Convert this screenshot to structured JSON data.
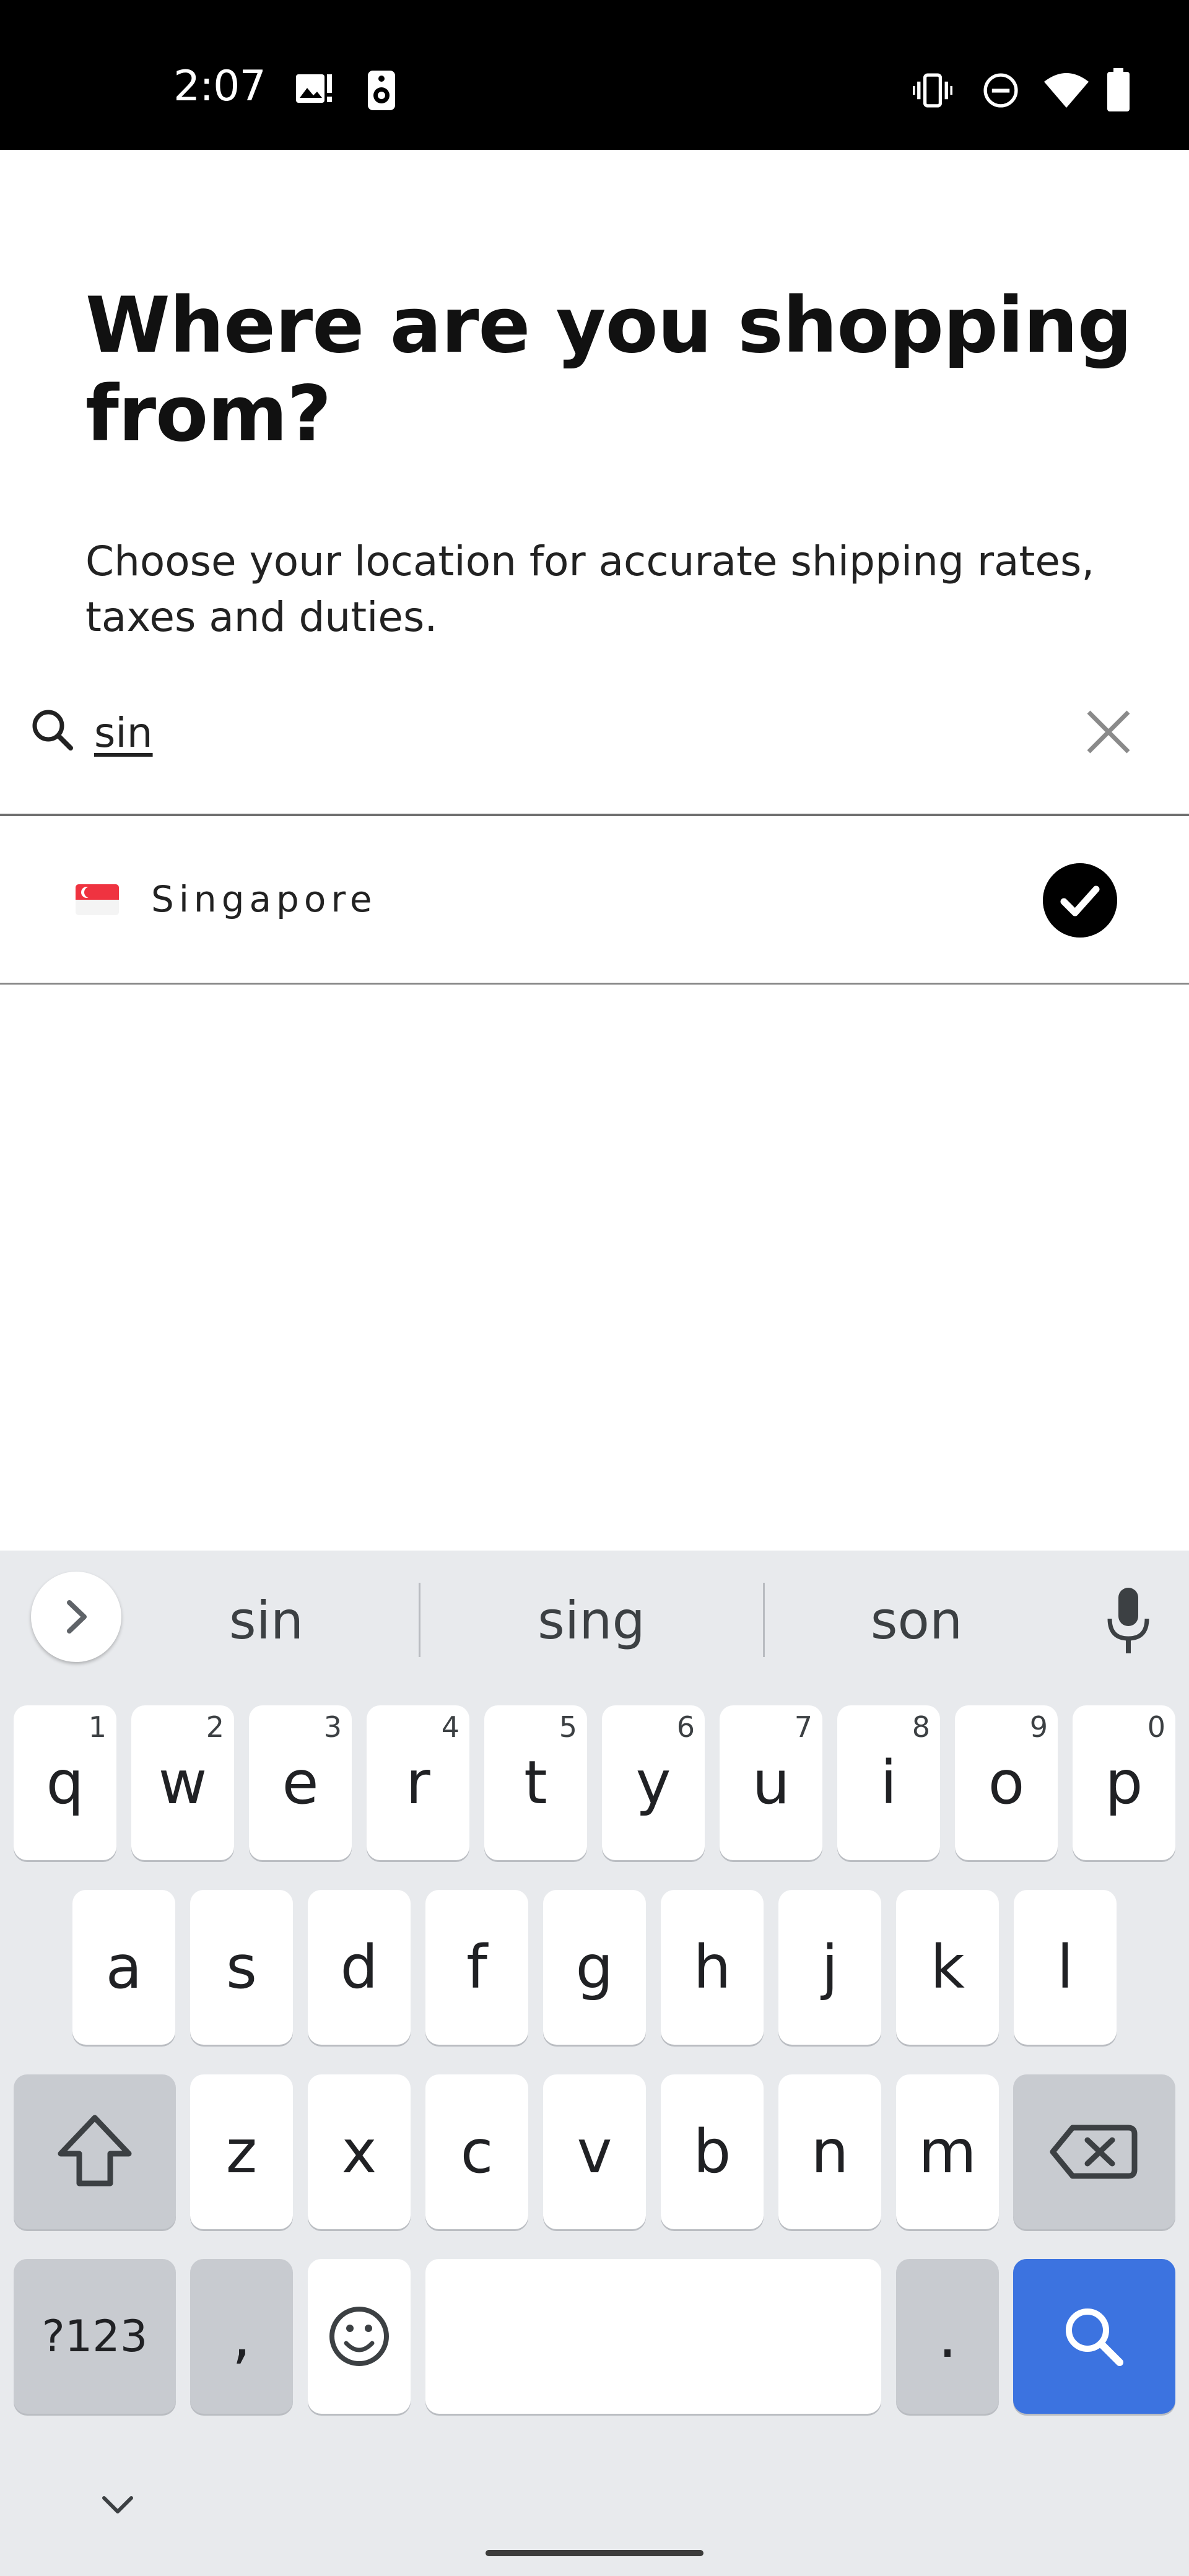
{
  "status_bar": {
    "time": "2:07",
    "left_icons": [
      "image-alert-icon",
      "speaker-icon"
    ],
    "right_icons": [
      "vibrate-icon",
      "do-not-disturb-icon",
      "wifi-icon",
      "battery-icon"
    ]
  },
  "page": {
    "title": "Where are you shopping from?",
    "subtitle": "Choose your location for accurate shipping rates, taxes and duties."
  },
  "search": {
    "value": "sin",
    "icon": "search-icon",
    "clear_icon": "close-icon"
  },
  "results": [
    {
      "flag": "singapore-flag-icon",
      "label": "Singapore",
      "selected": true
    }
  ],
  "keyboard": {
    "suggestions": [
      "sin",
      "sing",
      "son"
    ],
    "row1": [
      {
        "key": "q",
        "num": "1"
      },
      {
        "key": "w",
        "num": "2"
      },
      {
        "key": "e",
        "num": "3"
      },
      {
        "key": "r",
        "num": "4"
      },
      {
        "key": "t",
        "num": "5"
      },
      {
        "key": "y",
        "num": "6"
      },
      {
        "key": "u",
        "num": "7"
      },
      {
        "key": "i",
        "num": "8"
      },
      {
        "key": "o",
        "num": "9"
      },
      {
        "key": "p",
        "num": "0"
      }
    ],
    "row2": [
      "a",
      "s",
      "d",
      "f",
      "g",
      "h",
      "j",
      "k",
      "l"
    ],
    "row3": [
      "z",
      "x",
      "c",
      "v",
      "b",
      "n",
      "m"
    ],
    "symbols_label": "?123",
    "comma_label": ",",
    "period_label": ".",
    "colors": {
      "action_key": "#3c73e0",
      "background": "#e8eaed"
    }
  }
}
